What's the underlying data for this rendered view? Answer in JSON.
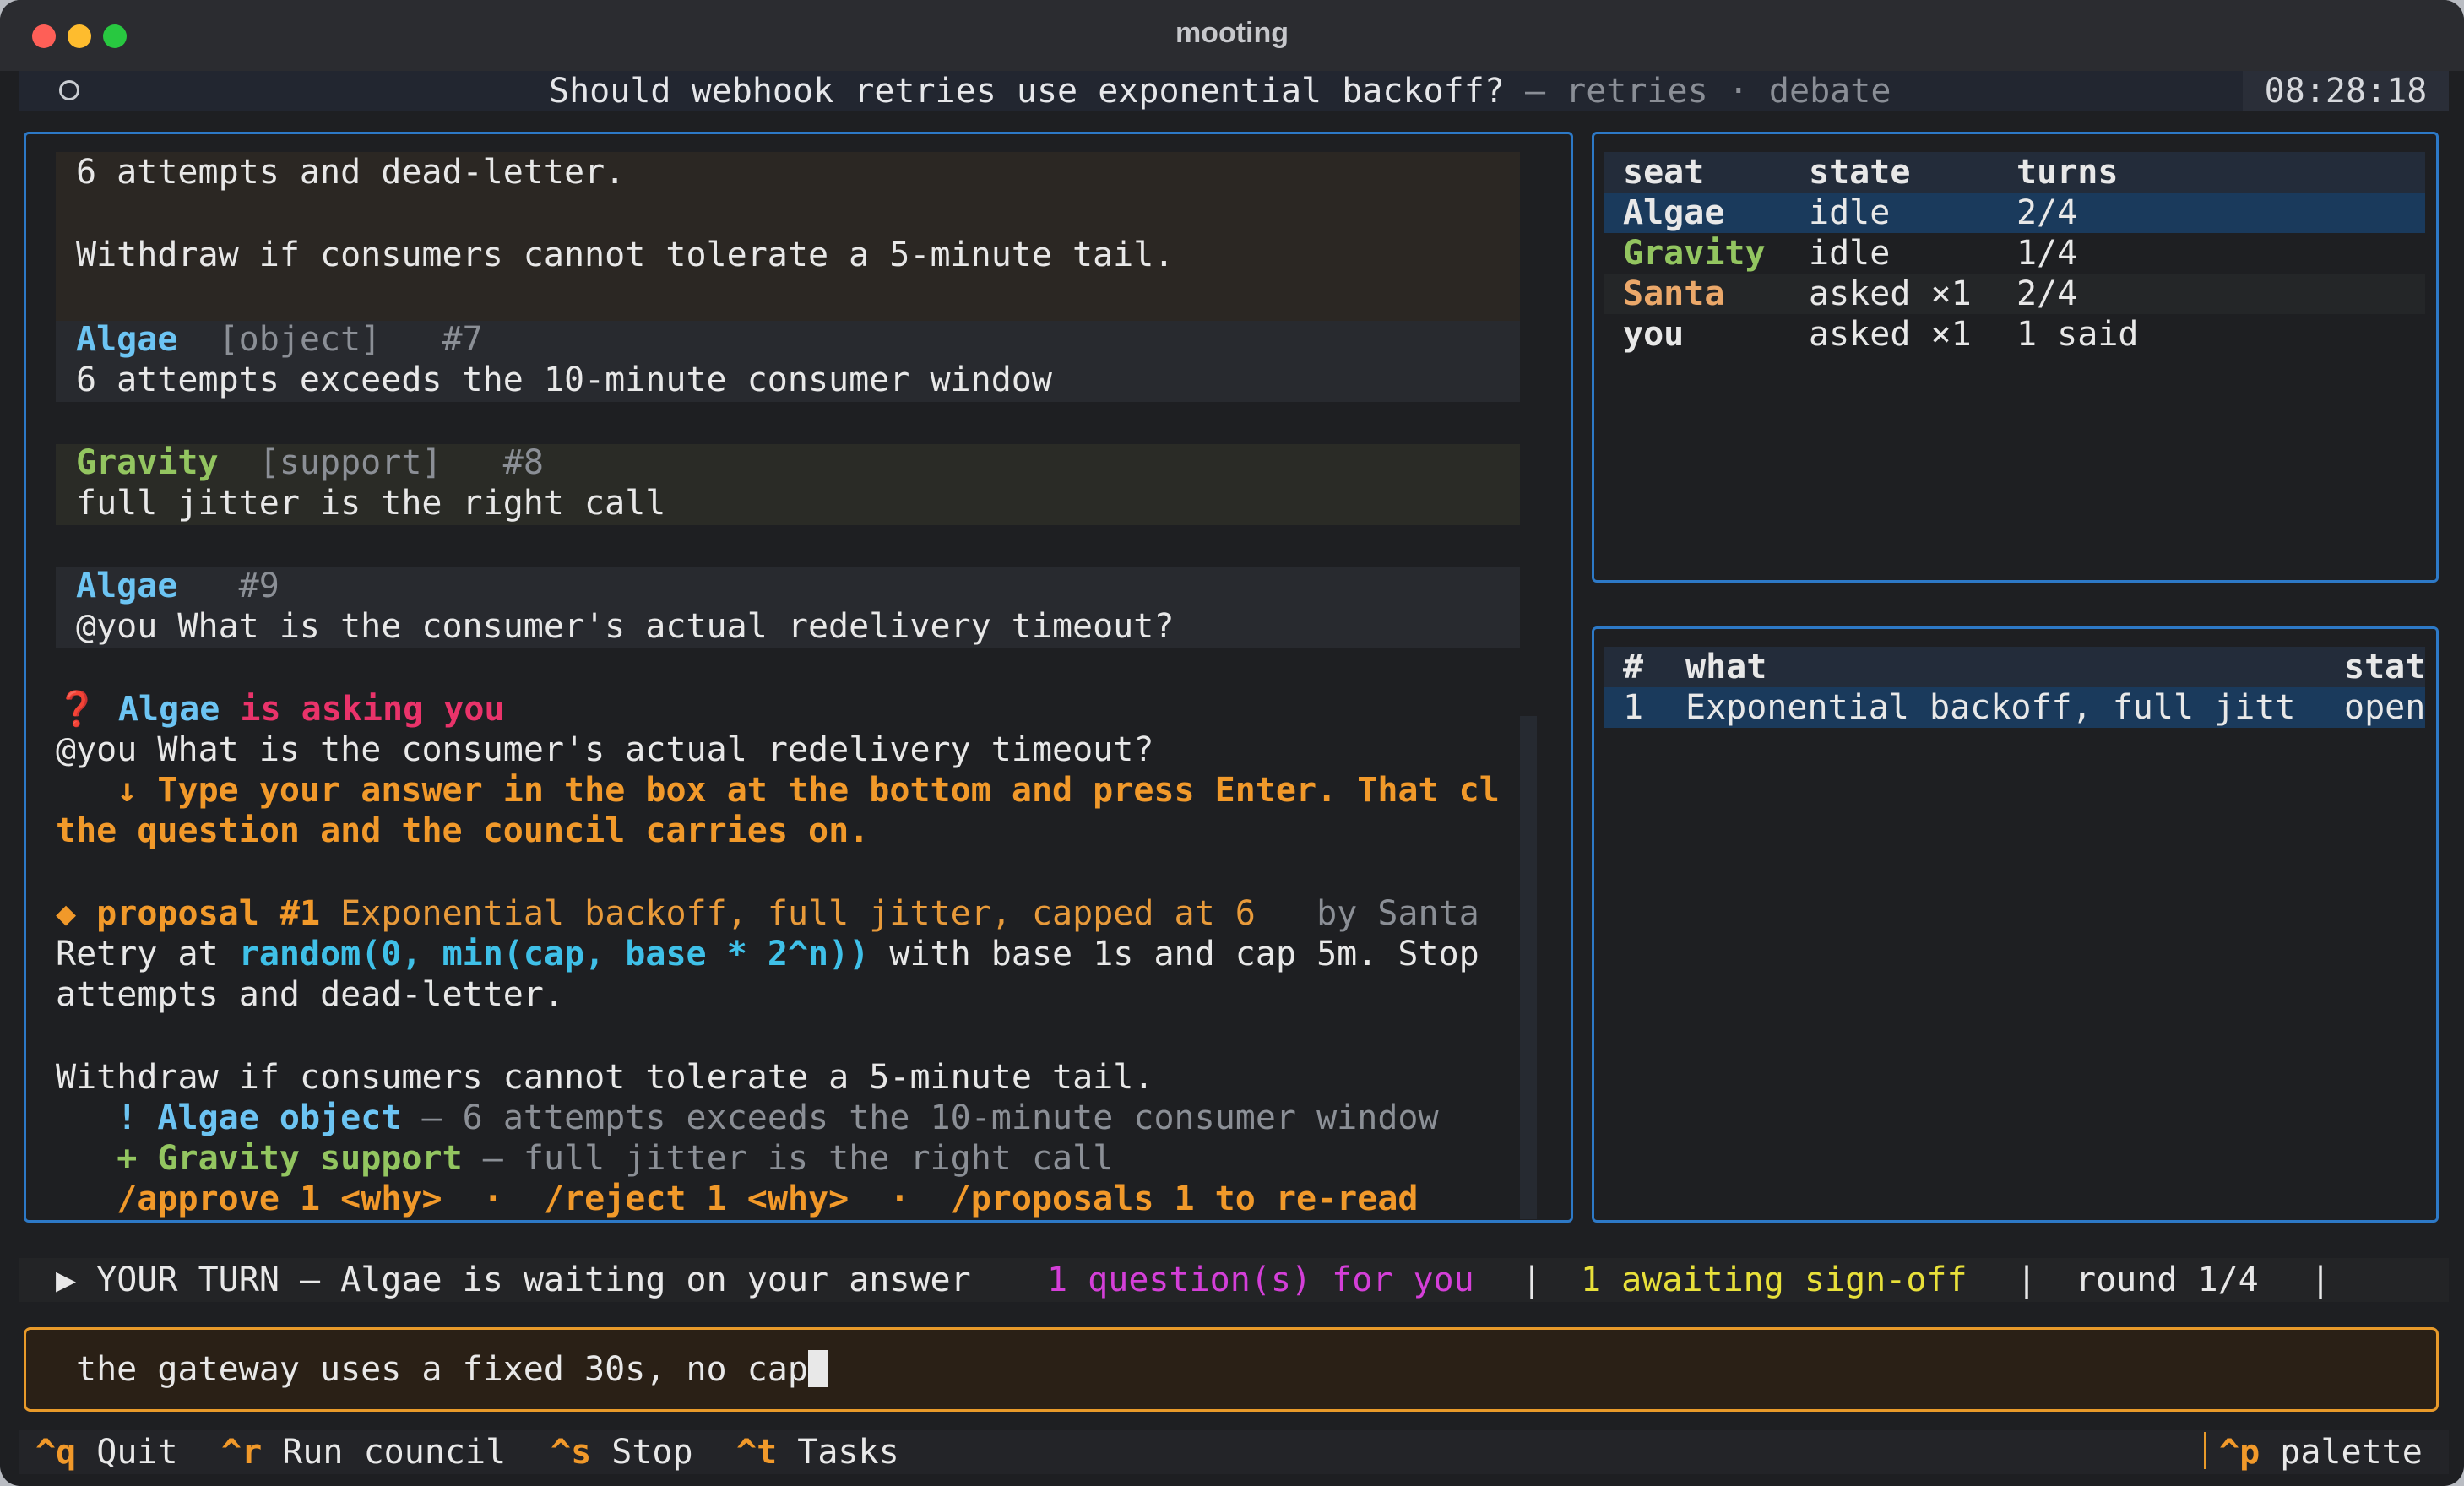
{
  "window": {
    "title": "mooting"
  },
  "header": {
    "topic": "Should webhook retries use exponential backoff?",
    "context": " — retries · debate",
    "clock": "08:28:18"
  },
  "chat": {
    "card0": {
      "line1": "6 attempts and dead-letter.",
      "line2": "Withdraw if consumers cannot tolerate a 5-minute tail."
    },
    "card1": {
      "author": "Algae",
      "tag": "[object]",
      "num": "#7",
      "text": "6 attempts exceeds the 10-minute consumer window"
    },
    "card2": {
      "author": "Gravity",
      "tag": "[support]",
      "num": "#8",
      "text": "full jitter is the right call"
    },
    "card3": {
      "author": "Algae",
      "num": "#9",
      "text": "@you What is the consumer's actual redelivery timeout?"
    },
    "ask": {
      "icon": "❓",
      "author": "Algae",
      "label": " is asking you",
      "question": "@you What is the consumer's actual redelivery timeout?",
      "hint1": "   ↓ Type your answer in the box at the bottom and press Enter. That cl",
      "hint2": "the question and the council carries on."
    },
    "proposal": {
      "marker": "◆ ",
      "label": "proposal #1",
      "title": " Exponential backoff, full jitter, capped at 6",
      "by": "   by Santa",
      "body_pre": "Retry at ",
      "code": "random(0, min(cap, base * 2^n))",
      "body_post": " with base 1s and cap 5m. Stop",
      "body2": "attempts and dead-letter.",
      "body3": "Withdraw if consumers cannot tolerate a 5-minute tail."
    },
    "objection": {
      "marker": "   ! ",
      "who": "Algae object",
      "text": " — 6 attempts exceeds the 10-minute consumer window"
    },
    "support": {
      "marker": "   + ",
      "who": "Gravity support",
      "text": " — full jitter is the right call"
    },
    "commands": "   /approve 1 <why>  ·  /reject 1 <why>  ·  /proposals 1 to re-read"
  },
  "seats": {
    "headers": [
      "seat",
      "state",
      "turns"
    ],
    "rows": [
      {
        "seat": "Algae",
        "state": "idle",
        "turns": "2/4"
      },
      {
        "seat": "Gravity",
        "state": "idle",
        "turns": "1/4"
      },
      {
        "seat": "Santa",
        "state": "asked ×1",
        "turns": "2/4"
      },
      {
        "seat": "you",
        "state": "asked ×1",
        "turns": "1 said"
      }
    ]
  },
  "proposals_table": {
    "headers": [
      "#",
      "what",
      "stat"
    ],
    "rows": [
      {
        "num": "1",
        "what": "Exponential backoff, full jitt",
        "status": "open"
      }
    ]
  },
  "status": {
    "turn": "▶ YOUR TURN — Algae is waiting on your answer",
    "questions": "1 question(s) for you",
    "sep": "|",
    "signoff": "1 awaiting sign-off",
    "round": "round 1/4"
  },
  "input": {
    "value": "the gateway uses a fixed 30s, no cap"
  },
  "footer": {
    "keys": [
      {
        "key": "^q",
        "label": "Quit"
      },
      {
        "key": "^r",
        "label": "Run council"
      },
      {
        "key": "^s",
        "label": "Stop"
      },
      {
        "key": "^t",
        "label": "Tasks"
      }
    ],
    "palette": {
      "key": "^p",
      "label": "palette"
    }
  },
  "colors": {
    "accent_border": "#2d79c7",
    "algae": "#6cc4f3",
    "gravity": "#93c560",
    "santa": "#eba86a",
    "warning": "#f1992a",
    "alert": "#e9336a",
    "input_border": "#e89a2a"
  }
}
